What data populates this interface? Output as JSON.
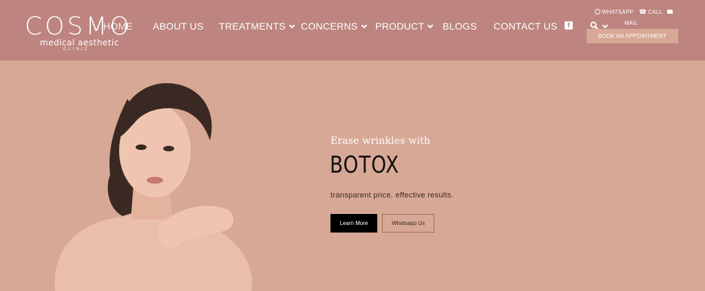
{
  "logo": {
    "word": "COSMO",
    "sub": "medical aesthetic",
    "clinic": "CLINIC"
  },
  "nav": {
    "home": "HOME",
    "items": [
      {
        "label": "ABOUT US",
        "dropdown": false
      },
      {
        "label": "TREATMENTS",
        "dropdown": true
      },
      {
        "label": "CONCERNS",
        "dropdown": true
      },
      {
        "label": "PRODUCT",
        "dropdown": true
      },
      {
        "label": "BLOGS",
        "dropdown": false
      },
      {
        "label": "CONTACT US",
        "dropdown": false
      }
    ]
  },
  "top_links": {
    "whatsapp": "WHATSAPP",
    "call": "CALL",
    "mail": "MAIL"
  },
  "book_label": "BOOK AN APPOINTMENT",
  "hero": {
    "tagline": "Erase wrinkles with",
    "title": "BOTOX",
    "description": "transparent price. effective results.",
    "learn_more": "Learn More",
    "whatsapp_us": "Whatsapp Us"
  },
  "icons": {
    "facebook": "facebook-icon",
    "search": "search-icon",
    "whatsapp": "whatsapp-icon",
    "phone": "phone-icon",
    "mail": "mail-icon"
  },
  "colors": {
    "header_bg": "#bd8480",
    "hero_bg": "#d7a895",
    "button_dark": "#000000",
    "text_dark": "#111111"
  }
}
